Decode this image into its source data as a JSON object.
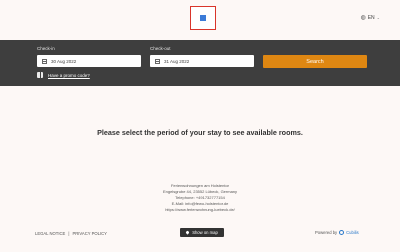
{
  "header": {
    "logo_icon": "hotel-logo-icon",
    "language_label": "EN"
  },
  "search": {
    "checkin_label": "Check-in",
    "checkin_value": "30 Aug 2022",
    "checkout_label": "Check-out",
    "checkout_value": "31 Aug 2022",
    "search_button": "Search",
    "promo_text": "Have a promo code?"
  },
  "main": {
    "message": "Please select the period of your stay to see available rooms."
  },
  "address": {
    "lines": [
      "Ferienwohnungen am Holstentor",
      "Engelsgrube 44, 23552 Lübeck, Germany",
      "Telephone: +491732777154",
      "E-Mail: info@fewo-holstentor.de",
      "https://www.ferienwohnung-luebeck.de/"
    ]
  },
  "footer": {
    "legal_notice": "LEGAL NOTICE",
    "separator": "|",
    "privacy_policy": "PRIVACY POLICY",
    "map_button": "Show on map",
    "powered_by": "Powered by",
    "brand": "Cubilis"
  },
  "colors": {
    "page_bg": "#fdf8f6",
    "bar_bg": "#3e3e3e",
    "accent": "#df8712",
    "brand_blue": "#2a79c9"
  }
}
